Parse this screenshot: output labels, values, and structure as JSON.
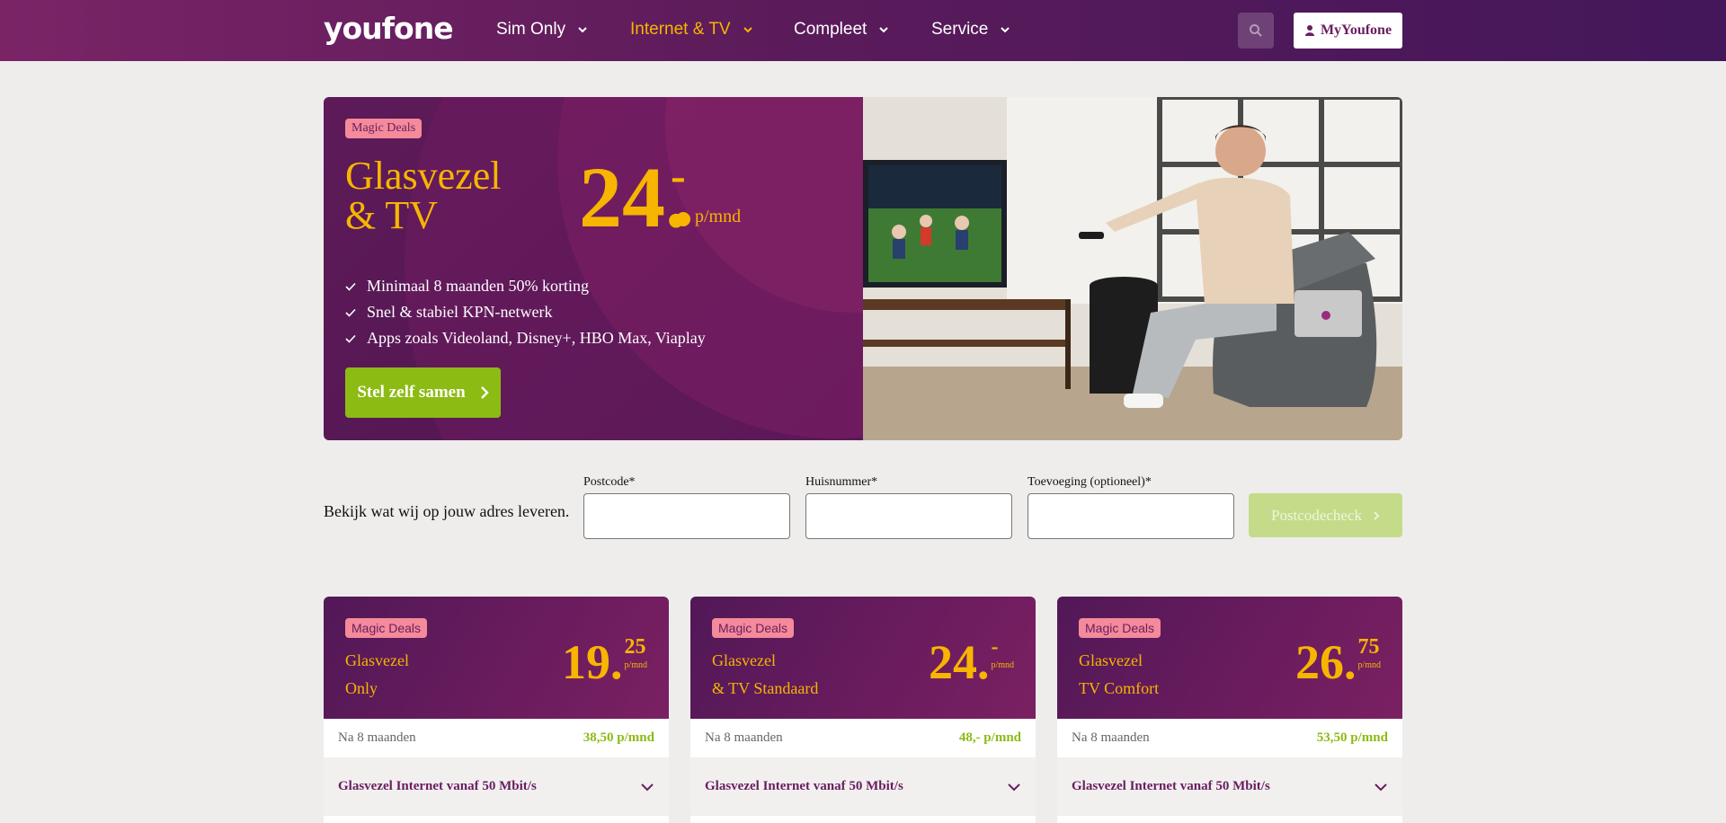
{
  "nav": {
    "logo": "youfone",
    "items": [
      {
        "label": "Sim Only"
      },
      {
        "label": "Internet & TV"
      },
      {
        "label": "Compleet"
      },
      {
        "label": "Service"
      }
    ],
    "account_label": "MyYoufone",
    "active_color": "#f7b500"
  },
  "hero": {
    "badge": "Magic Deals",
    "title_line1": "Glasvezel",
    "title_line2": "& TV",
    "price": "24.",
    "price_suffix": "-",
    "price_unit": "p/mnd",
    "usps": [
      "Minimaal 8 maanden 50% korting",
      "Snel & stabiel KPN-netwerk",
      "Apps zoals Videoland, Disney+, HBO Max, Viaplay"
    ],
    "cta_label": "Stel zelf samen"
  },
  "address": {
    "intro": "Bekijk wat wij op jouw adres leveren.",
    "postcode_label": "Postcode*",
    "huisnummer_label": "Huisnummer*",
    "toevoeging_label": "Toevoeging (optioneel)*",
    "button_label": "Postcodecheck"
  },
  "cards": [
    {
      "badge": "Magic Deals",
      "name1": "Glasvezel",
      "name2": "Only",
      "price_int": "19.",
      "price_dec": "25",
      "unit": "p/mnd",
      "after_label": "Na 8 maanden",
      "after_value": "38,50 p/mnd",
      "accordion": "Glasvezel Internet vanaf 50 Mbit/s"
    },
    {
      "badge": "Magic Deals",
      "name1": "Glasvezel",
      "name2": "& TV Standaard",
      "price_int": "24.",
      "price_dec": "-",
      "unit": "p/mnd",
      "after_label": "Na 8 maanden",
      "after_value": "48,- p/mnd",
      "accordion": "Glasvezel Internet vanaf 50 Mbit/s"
    },
    {
      "badge": "Magic Deals",
      "name1": "Glasvezel",
      "name2": "TV Comfort",
      "price_int": "26.",
      "price_dec": "75",
      "unit": "p/mnd",
      "after_label": "Na 8 maanden",
      "after_value": "53,50 p/mnd",
      "accordion": "Glasvezel Internet vanaf 50 Mbit/s"
    }
  ]
}
